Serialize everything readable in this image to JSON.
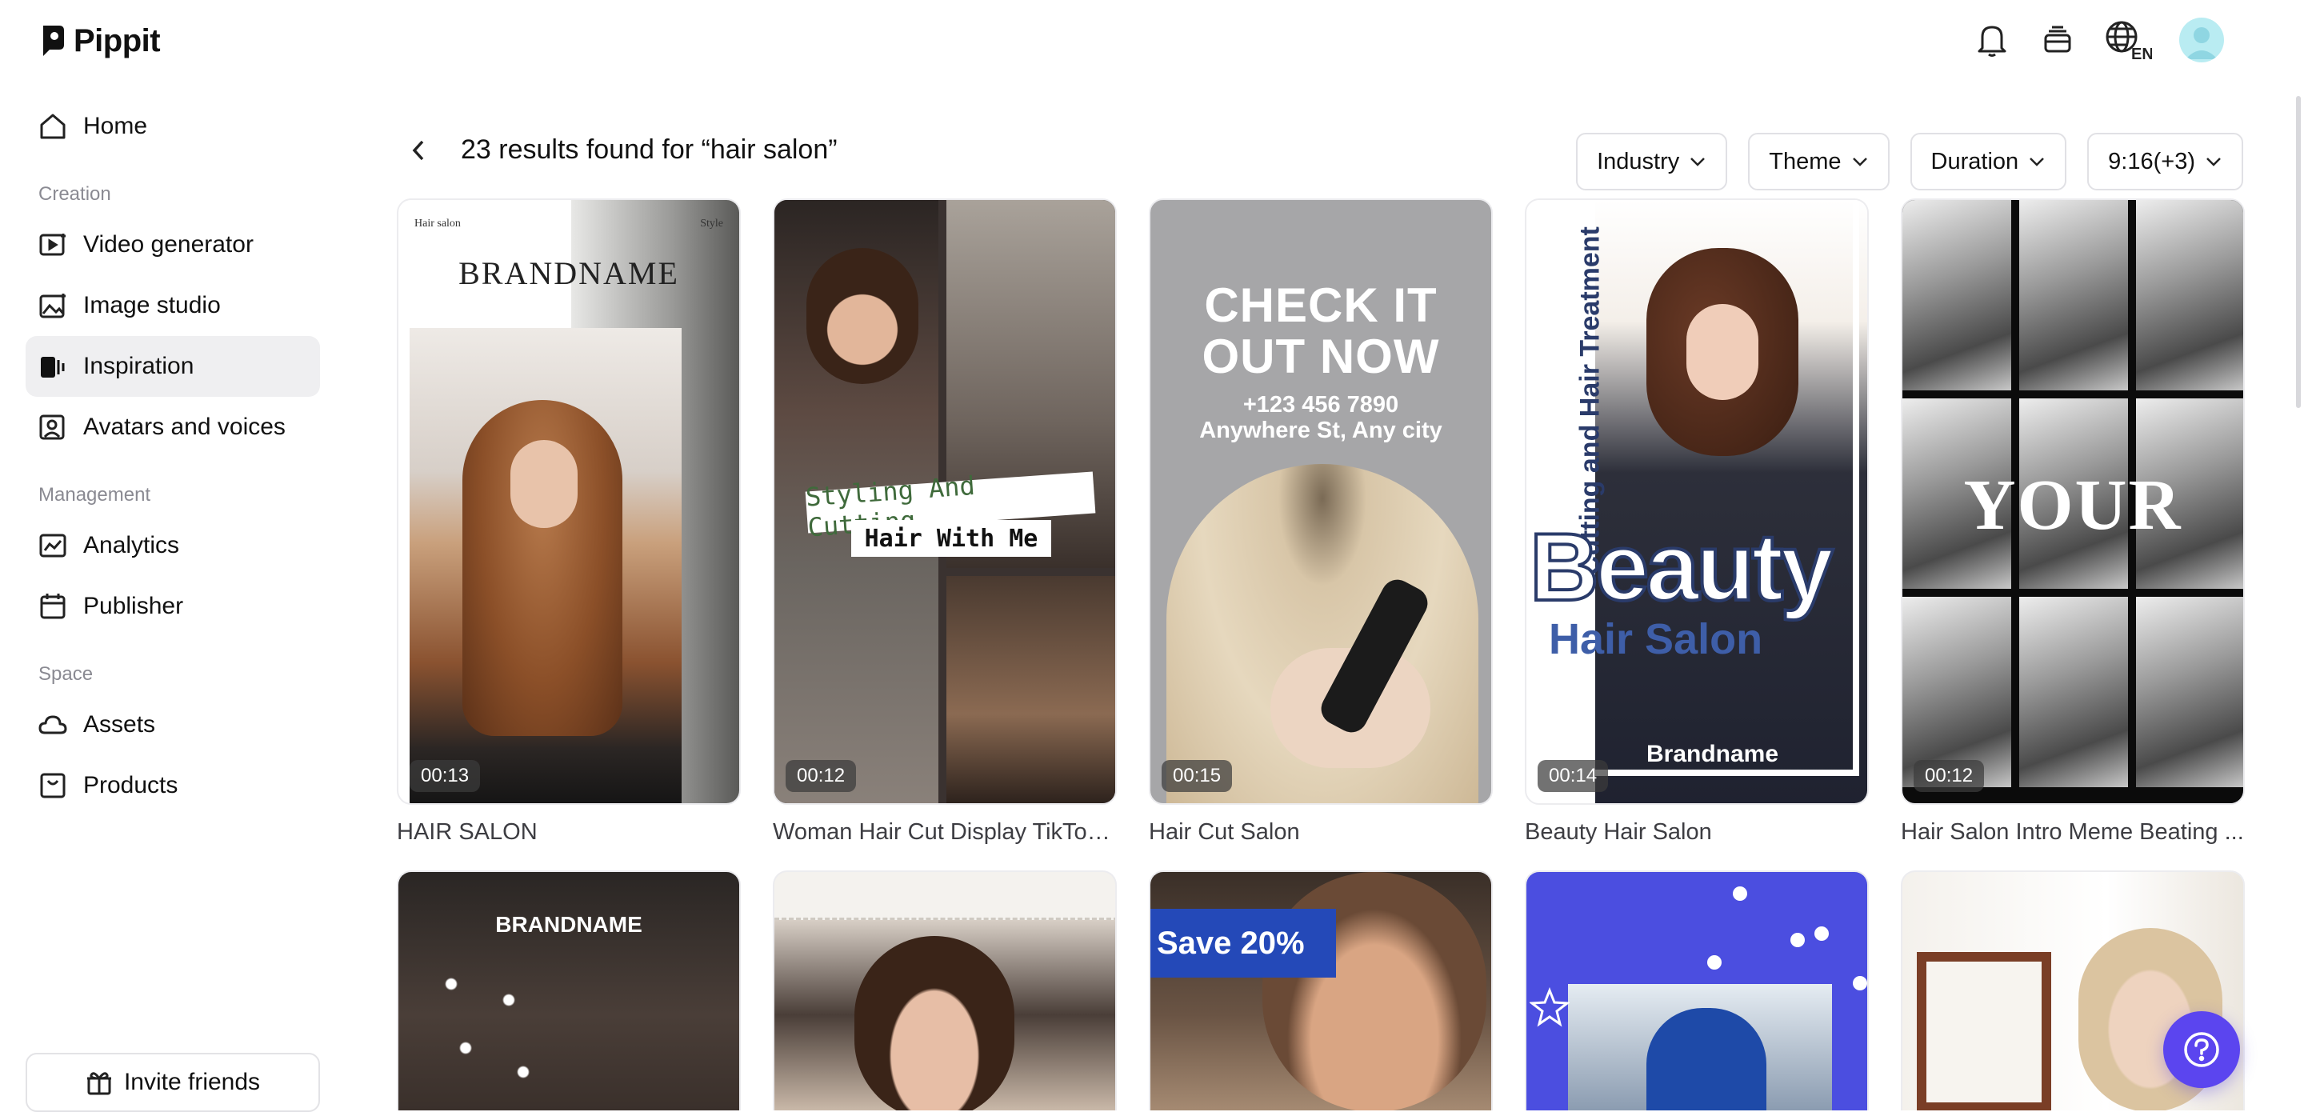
{
  "app": {
    "name": "Pippit",
    "accent": "#5b45ef"
  },
  "topbar": {
    "icons": [
      "bell-icon",
      "layers-icon",
      "globe-language-icon",
      "avatar"
    ],
    "language_label": "EN"
  },
  "sidebar": {
    "home": "Home",
    "sections": [
      {
        "label": "Creation",
        "items": [
          "Video generator",
          "Image studio",
          "Inspiration",
          "Avatars and voices"
        ]
      },
      {
        "label": "Management",
        "items": [
          "Analytics",
          "Publisher"
        ]
      },
      {
        "label": "Space",
        "items": [
          "Assets",
          "Products"
        ]
      }
    ],
    "active": "Inspiration",
    "invite_label": "Invite friends"
  },
  "main": {
    "results_title": "23 results found for “hair salon”",
    "filters": [
      "Industry",
      "Theme",
      "Duration",
      "9:16(+3)"
    ],
    "templates": [
      {
        "title": "HAIR SALON",
        "duration": "00:13",
        "overlay": {
          "brand": "BRANDNAME",
          "left": "Hair salon",
          "right": "Style"
        }
      },
      {
        "title": "Woman Hair Cut Display TikTok ...",
        "duration": "00:12",
        "overlay": {
          "line1": "Styling And Cutting",
          "line2": "Hair With Me"
        }
      },
      {
        "title": "Hair Cut Salon",
        "duration": "00:15",
        "overlay": {
          "headline": "CHECK IT OUT NOW",
          "phone": "+123 456 7890",
          "address": "Anywhere St, Any city"
        }
      },
      {
        "title": "Beauty Hair Salon",
        "duration": "00:14",
        "overlay": {
          "vertical": "Cutting and Hair Treatment",
          "big": "Beauty",
          "sub": "Hair Salon",
          "brand": "Brandname"
        }
      },
      {
        "title": "Hair Salon Intro Meme Beating ...",
        "duration": "00:12",
        "overlay": {
          "word": "YOUR"
        }
      }
    ],
    "partial_row": [
      {
        "overlay": "BRANDNAME"
      },
      {
        "overlay": ""
      },
      {
        "overlay": "Save 20%"
      },
      {
        "overlay": ""
      },
      {
        "overlay": ""
      }
    ]
  }
}
